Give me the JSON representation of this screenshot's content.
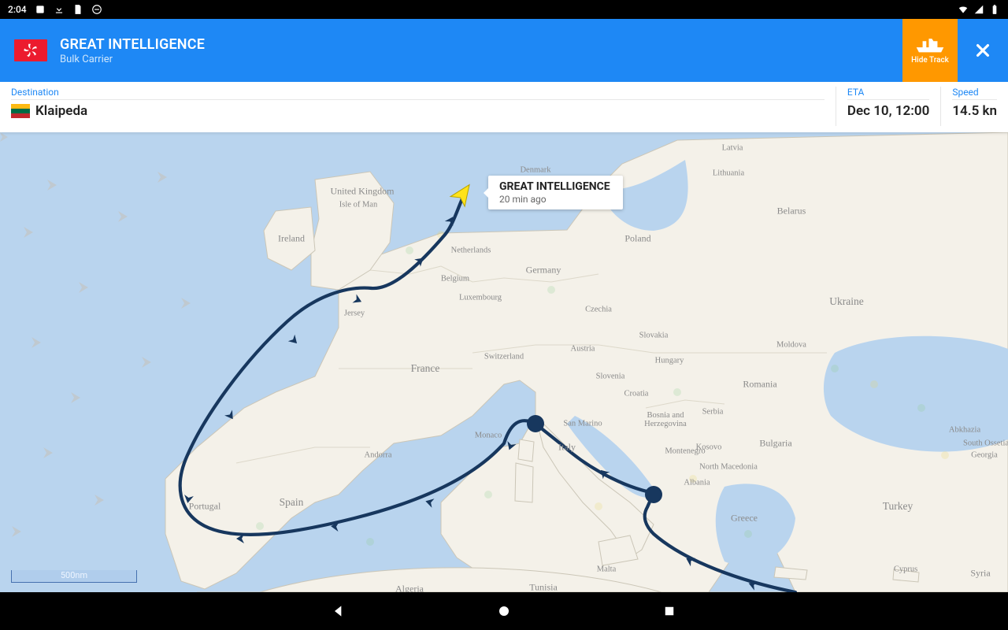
{
  "status_bar": {
    "time": "2:04"
  },
  "header": {
    "vessel_name": "GREAT INTELLIGENCE",
    "vessel_type": "Bulk Carrier",
    "hide_track_label": "Hide Track"
  },
  "info": {
    "destination_label": "Destination",
    "destination_value": "Klaipeda",
    "eta_label": "ETA",
    "eta_value": "Dec 10, 12:00",
    "speed_label": "Speed",
    "speed_value": "14.5 kn"
  },
  "callout": {
    "title": "GREAT INTELLIGENCE",
    "ago": "20 min ago"
  },
  "scale": {
    "label": "500nm"
  },
  "countries": {
    "uk": "United Kingdom",
    "iom": "Isle of Man",
    "ireland": "Ireland",
    "netherlands": "Netherlands",
    "belgium": "Belgium",
    "luxembourg": "Luxembourg",
    "germany": "Germany",
    "denmark": "Denmark",
    "latvia": "Latvia",
    "lithuania": "Lithuania",
    "belarus": "Belarus",
    "poland": "Poland",
    "czechia": "Czechia",
    "slovakia": "Slovakia",
    "austria": "Austria",
    "switzerland": "Switzerland",
    "jersey": "Jersey",
    "france": "France",
    "spain": "Spain",
    "portugal": "Portugal",
    "andorra": "Andorra",
    "monaco": "Monaco",
    "italy": "Italy",
    "sanmarino": "San Marino",
    "slovenia": "Slovenia",
    "croatia": "Croatia",
    "bih": "Bosnia and\nHerzegovina",
    "montenegro": "Montenegro",
    "serbia": "Serbia",
    "kosovo": "Kosovo",
    "nmacedonia": "North Macedonia",
    "albania": "Albania",
    "bulgaria": "Bulgaria",
    "romania": "Romania",
    "moldova": "Moldova",
    "hungary": "Hungary",
    "ukraine": "Ukraine",
    "greece": "Greece",
    "turkey": "Turkey",
    "cyprus": "Cyprus",
    "syria": "Syria",
    "georgia": "Georgia",
    "abkhazia": "Abkhazia",
    "southossetia": "South Ossetia",
    "malta": "Malta",
    "tunisia": "Tunisia",
    "algeria": "Algeria"
  }
}
